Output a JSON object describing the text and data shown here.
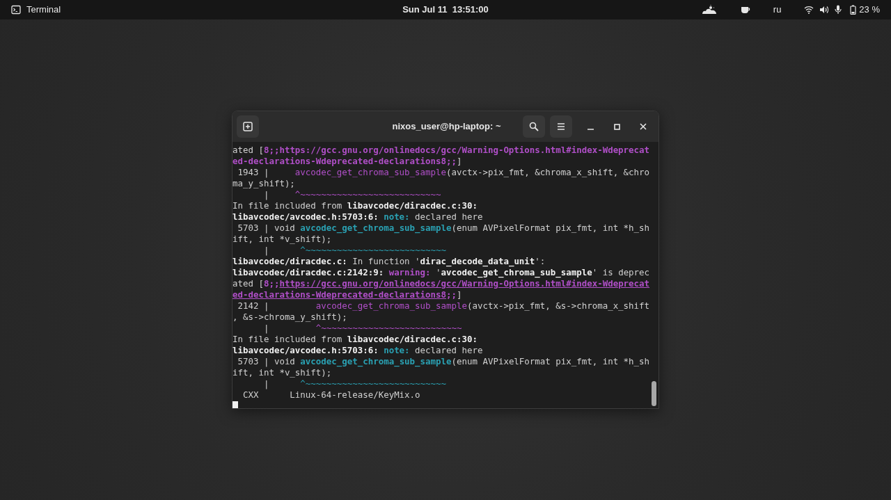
{
  "top_bar": {
    "app_name": "Terminal",
    "clock": "Sun Jul 11  13:51:00",
    "keyboard_layout": "ru",
    "battery": "23 %"
  },
  "window": {
    "title": "nixos_user@hp-laptop: ~"
  },
  "terminal": {
    "lines": [
      [
        {
          "text": "ated [",
          "kind": "plain"
        },
        {
          "text": "8;;https://gcc.gnu.org/onlinedocs/gcc/Warning-Options.html#index-Wdeprecat",
          "kind": "warning"
        }
      ],
      [
        {
          "text": "ed-declarations-Wdeprecated-declarations8;;",
          "kind": "warning"
        },
        {
          "text": "]",
          "kind": "plain"
        }
      ],
      [
        {
          "text": " 1943 |     ",
          "kind": "plain"
        },
        {
          "text": "avcodec_get_chroma_sub_sample",
          "kind": "function"
        },
        {
          "text": "(avctx->pix_fmt, &chroma_x_shift, &chro",
          "kind": "plain"
        }
      ],
      [
        {
          "text": "ma_y_shift);",
          "kind": "plain"
        }
      ],
      [
        {
          "text": "      |     ",
          "kind": "plain"
        },
        {
          "text": "^~~~~~~~~~~~~~~~~~~~~~~~~~~~",
          "kind": "function"
        }
      ],
      [
        {
          "text": "In file included from ",
          "kind": "plain"
        },
        {
          "text": "libavcodec/diracdec.c:30:",
          "kind": "bold"
        }
      ],
      [
        {
          "text": "libavcodec/avcodec.h:5703:6: ",
          "kind": "bold"
        },
        {
          "text": "note:",
          "kind": "note"
        },
        {
          "text": " declared here",
          "kind": "plain"
        }
      ],
      [
        {
          "text": " 5703 | void ",
          "kind": "plain"
        },
        {
          "text": "avcodec_get_chroma_sub_sample",
          "kind": "note"
        },
        {
          "text": "(enum AVPixelFormat pix_fmt, int *h_sh",
          "kind": "plain"
        }
      ],
      [
        {
          "text": "ift, int *v_shift);",
          "kind": "plain"
        }
      ],
      [
        {
          "text": "      |      ",
          "kind": "plain"
        },
        {
          "text": "^~~~~~~~~~~~~~~~~~~~~~~~~~~~",
          "kind": "caret"
        }
      ],
      [
        {
          "text": "libavcodec/diracdec.c:",
          "kind": "bold"
        },
        {
          "text": " In function '",
          "kind": "plain"
        },
        {
          "text": "dirac_decode_data_unit",
          "kind": "bold"
        },
        {
          "text": "':",
          "kind": "plain"
        }
      ],
      [
        {
          "text": "libavcodec/diracdec.c:2142:9: ",
          "kind": "bold"
        },
        {
          "text": "warning: ",
          "kind": "warning"
        },
        {
          "text": "'",
          "kind": "plain"
        },
        {
          "text": "avcodec_get_chroma_sub_sample",
          "kind": "bold"
        },
        {
          "text": "' is deprec",
          "kind": "plain"
        }
      ],
      [
        {
          "text": "ated [",
          "kind": "plain"
        },
        {
          "text": "8;;",
          "kind": "warning"
        },
        {
          "text": "https://gcc.gnu.org/onlinedocs/gcc/Warning-Options.html#index-Wdeprecat",
          "kind": "link"
        }
      ],
      [
        {
          "text": "ed-declarations-Wdeprecated-declarations8",
          "kind": "link"
        },
        {
          "text": ";;",
          "kind": "warning"
        },
        {
          "text": "]",
          "kind": "plain"
        }
      ],
      [
        {
          "text": " 2142 |         ",
          "kind": "plain"
        },
        {
          "text": "avcodec_get_chroma_sub_sample",
          "kind": "function"
        },
        {
          "text": "(avctx->pix_fmt, &s->chroma_x_shift",
          "kind": "plain"
        }
      ],
      [
        {
          "text": ", &s->chroma_y_shift);",
          "kind": "plain"
        }
      ],
      [
        {
          "text": "      |         ",
          "kind": "plain"
        },
        {
          "text": "^~~~~~~~~~~~~~~~~~~~~~~~~~~~",
          "kind": "function"
        }
      ],
      [
        {
          "text": "In file included from ",
          "kind": "plain"
        },
        {
          "text": "libavcodec/diracdec.c:30:",
          "kind": "bold"
        }
      ],
      [
        {
          "text": "libavcodec/avcodec.h:5703:6: ",
          "kind": "bold"
        },
        {
          "text": "note:",
          "kind": "note"
        },
        {
          "text": " declared here",
          "kind": "plain"
        }
      ],
      [
        {
          "text": " 5703 | void ",
          "kind": "plain"
        },
        {
          "text": "avcodec_get_chroma_sub_sample",
          "kind": "note"
        },
        {
          "text": "(enum AVPixelFormat pix_fmt, int *h_sh",
          "kind": "plain"
        }
      ],
      [
        {
          "text": "ift, int *v_shift);",
          "kind": "plain"
        }
      ],
      [
        {
          "text": "      |      ",
          "kind": "plain"
        },
        {
          "text": "^~~~~~~~~~~~~~~~~~~~~~~~~~~~",
          "kind": "caret"
        }
      ],
      [
        {
          "text": "  CXX      Linux-64-release/KeyMix.o",
          "kind": "plain"
        }
      ]
    ]
  }
}
